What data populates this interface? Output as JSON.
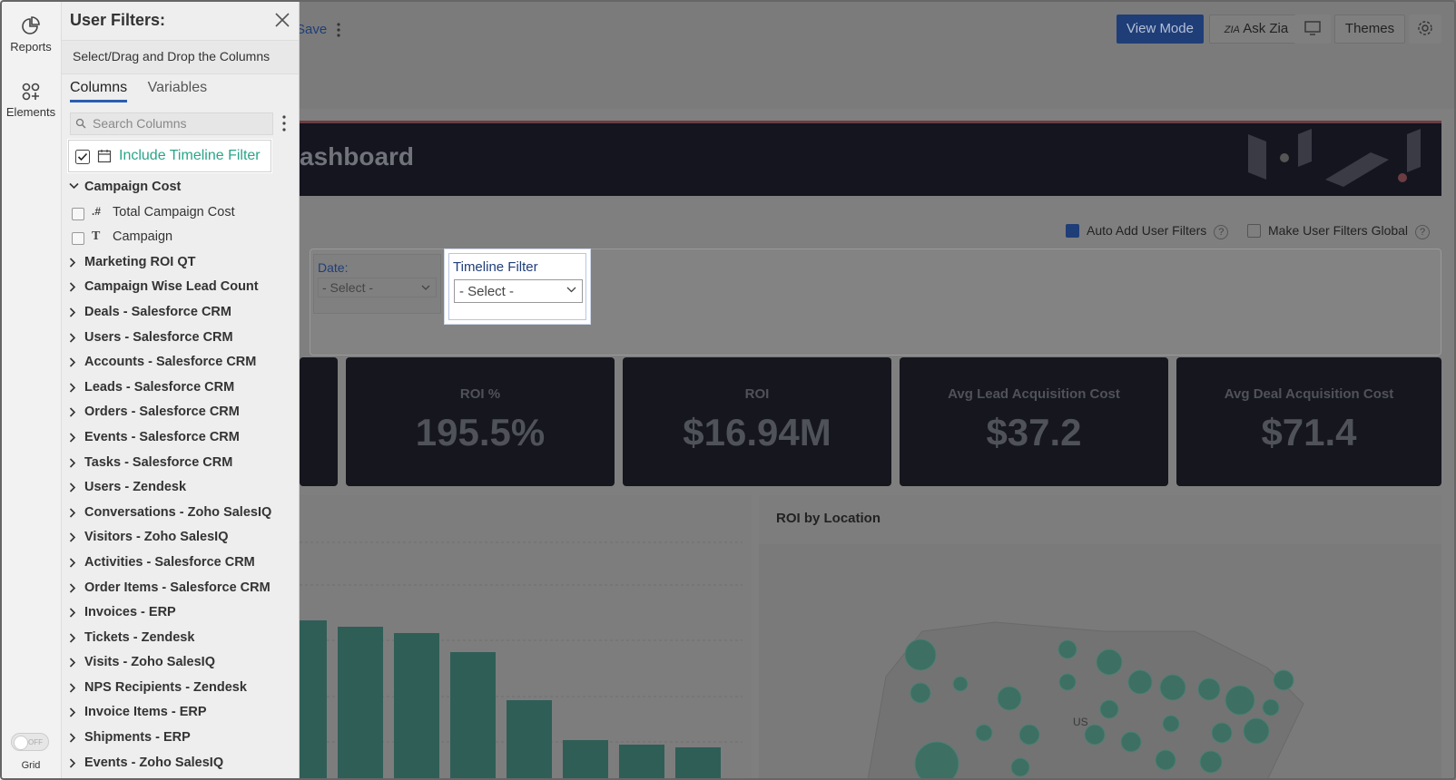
{
  "rail": {
    "reports_label": "Reports",
    "elements_label": "Elements",
    "grid_label": "Grid",
    "grid_toggle_state": "OFF"
  },
  "panel": {
    "title": "User Filters:",
    "subtitle": "Select/Drag and Drop the Columns",
    "tabs": [
      "Columns",
      "Variables"
    ],
    "active_tab": "Columns",
    "search_placeholder": "Search Columns",
    "timeline_label": "Include Timeline Filter",
    "timeline_checked": true,
    "expanded_group": "Campaign Cost",
    "children": [
      {
        "type_glyph": ".#",
        "label": "Total Campaign Cost",
        "checked": false
      },
      {
        "type_glyph": "T",
        "label": "Campaign",
        "checked": false
      }
    ],
    "groups": [
      "Marketing ROI QT",
      "Campaign Wise Lead Count",
      "Deals - Salesforce CRM",
      "Users - Salesforce CRM",
      "Accounts - Salesforce CRM",
      "Leads - Salesforce CRM",
      "Orders - Salesforce CRM",
      "Events - Salesforce CRM",
      "Tasks - Salesforce CRM",
      "Users - Zendesk",
      "Conversations - Zoho SalesIQ",
      "Visitors - Zoho SalesIQ",
      "Activities - Salesforce CRM",
      "Order Items - Salesforce CRM",
      "Invoices - ERP",
      "Tickets - Zendesk",
      "Visits - Zoho SalesIQ",
      "NPS Recipients - Zendesk",
      "Invoice Items - ERP",
      "Shipments - ERP",
      "Events - Zoho SalesIQ"
    ]
  },
  "toolbar": {
    "save_label": "Save",
    "view_mode_label": "View Mode",
    "ask_zia_label": "Ask Zia",
    "themes_label": "Themes"
  },
  "dashboard": {
    "title_fragment": "ashboard",
    "auto_add_label": "Auto Add User Filters",
    "auto_add_checked": true,
    "make_global_label": "Make User Filters Global",
    "make_global_checked": false,
    "help_glyph": "?",
    "date_filter_label": "Date:",
    "date_filter_value": "- Select -",
    "timeline_filter_label": "Timeline Filter",
    "timeline_filter_value": "- Select -",
    "kpis": [
      {
        "title": "ROI %",
        "value": "195.5%"
      },
      {
        "title": "ROI",
        "value": "$16.94M"
      },
      {
        "title": "Avg Lead Acquisition Cost",
        "value": "$37.2"
      },
      {
        "title": "Avg Deal Acquisition Cost",
        "value": "$71.4"
      }
    ],
    "map_title": "ROI by Location",
    "map_label": "US"
  },
  "colors": {
    "accent": "#1f3e78",
    "timeline_text": "#2aa58a",
    "overlay": "#7f7f7f"
  }
}
